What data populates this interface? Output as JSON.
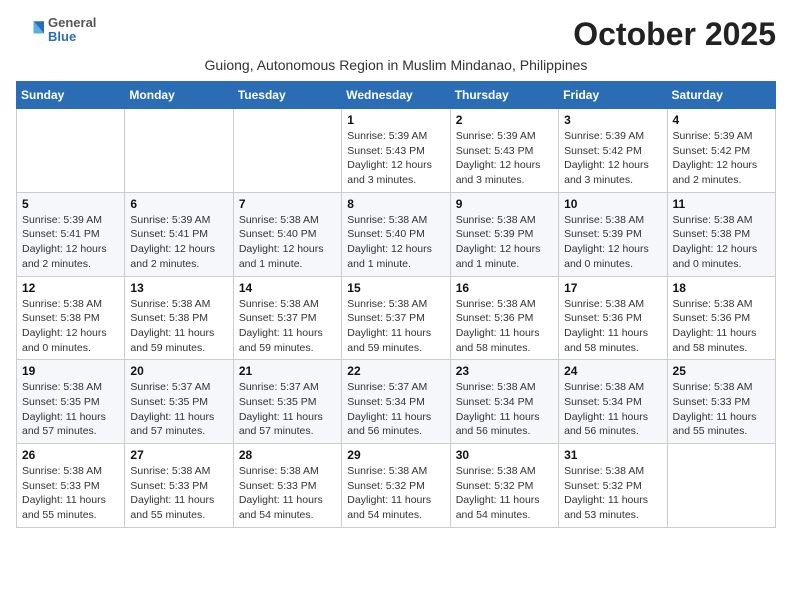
{
  "header": {
    "logo_general": "General",
    "logo_blue": "Blue",
    "month_title": "October 2025",
    "subtitle": "Guiong, Autonomous Region in Muslim Mindanao, Philippines"
  },
  "days_of_week": [
    "Sunday",
    "Monday",
    "Tuesday",
    "Wednesday",
    "Thursday",
    "Friday",
    "Saturday"
  ],
  "weeks": [
    [
      {
        "day": "",
        "info": ""
      },
      {
        "day": "",
        "info": ""
      },
      {
        "day": "",
        "info": ""
      },
      {
        "day": "1",
        "info": "Sunrise: 5:39 AM\nSunset: 5:43 PM\nDaylight: 12 hours\nand 3 minutes."
      },
      {
        "day": "2",
        "info": "Sunrise: 5:39 AM\nSunset: 5:43 PM\nDaylight: 12 hours\nand 3 minutes."
      },
      {
        "day": "3",
        "info": "Sunrise: 5:39 AM\nSunset: 5:42 PM\nDaylight: 12 hours\nand 3 minutes."
      },
      {
        "day": "4",
        "info": "Sunrise: 5:39 AM\nSunset: 5:42 PM\nDaylight: 12 hours\nand 2 minutes."
      }
    ],
    [
      {
        "day": "5",
        "info": "Sunrise: 5:39 AM\nSunset: 5:41 PM\nDaylight: 12 hours\nand 2 minutes."
      },
      {
        "day": "6",
        "info": "Sunrise: 5:39 AM\nSunset: 5:41 PM\nDaylight: 12 hours\nand 2 minutes."
      },
      {
        "day": "7",
        "info": "Sunrise: 5:38 AM\nSunset: 5:40 PM\nDaylight: 12 hours\nand 1 minute."
      },
      {
        "day": "8",
        "info": "Sunrise: 5:38 AM\nSunset: 5:40 PM\nDaylight: 12 hours\nand 1 minute."
      },
      {
        "day": "9",
        "info": "Sunrise: 5:38 AM\nSunset: 5:39 PM\nDaylight: 12 hours\nand 1 minute."
      },
      {
        "day": "10",
        "info": "Sunrise: 5:38 AM\nSunset: 5:39 PM\nDaylight: 12 hours\nand 0 minutes."
      },
      {
        "day": "11",
        "info": "Sunrise: 5:38 AM\nSunset: 5:38 PM\nDaylight: 12 hours\nand 0 minutes."
      }
    ],
    [
      {
        "day": "12",
        "info": "Sunrise: 5:38 AM\nSunset: 5:38 PM\nDaylight: 12 hours\nand 0 minutes."
      },
      {
        "day": "13",
        "info": "Sunrise: 5:38 AM\nSunset: 5:38 PM\nDaylight: 11 hours\nand 59 minutes."
      },
      {
        "day": "14",
        "info": "Sunrise: 5:38 AM\nSunset: 5:37 PM\nDaylight: 11 hours\nand 59 minutes."
      },
      {
        "day": "15",
        "info": "Sunrise: 5:38 AM\nSunset: 5:37 PM\nDaylight: 11 hours\nand 59 minutes."
      },
      {
        "day": "16",
        "info": "Sunrise: 5:38 AM\nSunset: 5:36 PM\nDaylight: 11 hours\nand 58 minutes."
      },
      {
        "day": "17",
        "info": "Sunrise: 5:38 AM\nSunset: 5:36 PM\nDaylight: 11 hours\nand 58 minutes."
      },
      {
        "day": "18",
        "info": "Sunrise: 5:38 AM\nSunset: 5:36 PM\nDaylight: 11 hours\nand 58 minutes."
      }
    ],
    [
      {
        "day": "19",
        "info": "Sunrise: 5:38 AM\nSunset: 5:35 PM\nDaylight: 11 hours\nand 57 minutes."
      },
      {
        "day": "20",
        "info": "Sunrise: 5:37 AM\nSunset: 5:35 PM\nDaylight: 11 hours\nand 57 minutes."
      },
      {
        "day": "21",
        "info": "Sunrise: 5:37 AM\nSunset: 5:35 PM\nDaylight: 11 hours\nand 57 minutes."
      },
      {
        "day": "22",
        "info": "Sunrise: 5:37 AM\nSunset: 5:34 PM\nDaylight: 11 hours\nand 56 minutes."
      },
      {
        "day": "23",
        "info": "Sunrise: 5:38 AM\nSunset: 5:34 PM\nDaylight: 11 hours\nand 56 minutes."
      },
      {
        "day": "24",
        "info": "Sunrise: 5:38 AM\nSunset: 5:34 PM\nDaylight: 11 hours\nand 56 minutes."
      },
      {
        "day": "25",
        "info": "Sunrise: 5:38 AM\nSunset: 5:33 PM\nDaylight: 11 hours\nand 55 minutes."
      }
    ],
    [
      {
        "day": "26",
        "info": "Sunrise: 5:38 AM\nSunset: 5:33 PM\nDaylight: 11 hours\nand 55 minutes."
      },
      {
        "day": "27",
        "info": "Sunrise: 5:38 AM\nSunset: 5:33 PM\nDaylight: 11 hours\nand 55 minutes."
      },
      {
        "day": "28",
        "info": "Sunrise: 5:38 AM\nSunset: 5:33 PM\nDaylight: 11 hours\nand 54 minutes."
      },
      {
        "day": "29",
        "info": "Sunrise: 5:38 AM\nSunset: 5:32 PM\nDaylight: 11 hours\nand 54 minutes."
      },
      {
        "day": "30",
        "info": "Sunrise: 5:38 AM\nSunset: 5:32 PM\nDaylight: 11 hours\nand 54 minutes."
      },
      {
        "day": "31",
        "info": "Sunrise: 5:38 AM\nSunset: 5:32 PM\nDaylight: 11 hours\nand 53 minutes."
      },
      {
        "day": "",
        "info": ""
      }
    ]
  ]
}
